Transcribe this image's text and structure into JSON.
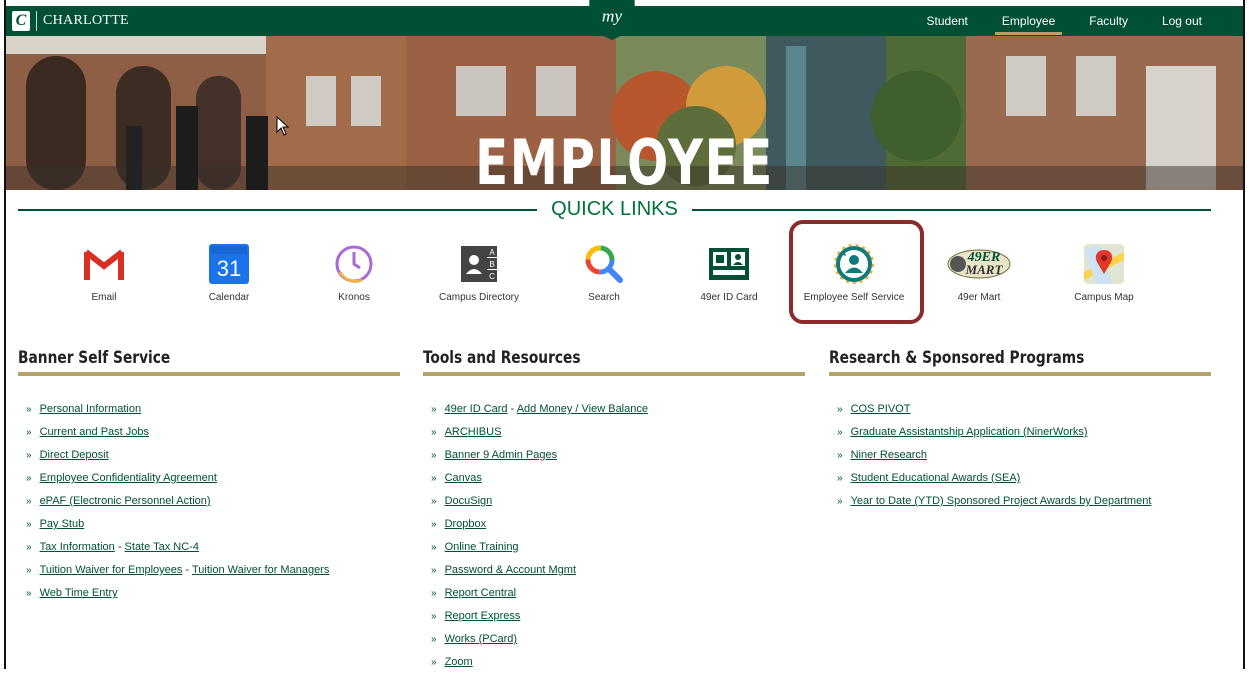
{
  "header": {
    "brand": "CHARLOTTE",
    "my_label": "my",
    "nav": [
      "Student",
      "Employee",
      "Faculty",
      "Log out"
    ],
    "active": "Employee"
  },
  "hero": {
    "title": "EMPLOYEE"
  },
  "quick_links": {
    "title": "QUICK LINKS",
    "items": [
      {
        "label": "Email",
        "icon": "gmail-icon"
      },
      {
        "label": "Calendar",
        "icon": "calendar-icon"
      },
      {
        "label": "Kronos",
        "icon": "clock-icon"
      },
      {
        "label": "Campus Directory",
        "icon": "directory-icon"
      },
      {
        "label": "Search",
        "icon": "search-icon"
      },
      {
        "label": "49er ID Card",
        "icon": "id-card-icon"
      },
      {
        "label": "Employee Self Service",
        "icon": "employee-self-service-icon"
      },
      {
        "label": "49er Mart",
        "icon": "49er-mart-logo"
      },
      {
        "label": "Campus Map",
        "icon": "map-icon"
      }
    ]
  },
  "banner": {
    "title": "Banner Self Service",
    "items": [
      [
        "Personal Information"
      ],
      [
        "Current and Past Jobs"
      ],
      [
        "Direct Deposit"
      ],
      [
        "Employee Confidentiality Agreement"
      ],
      [
        "ePAF (Electronic Personnel Action)"
      ],
      [
        "Pay Stub"
      ],
      [
        "Tax Information",
        "State Tax NC-4"
      ],
      [
        "Tuition Waiver for Employees",
        "Tuition Waiver for Managers"
      ],
      [
        "Web Time Entry"
      ]
    ]
  },
  "tools": {
    "title": "Tools and Resources",
    "items": [
      [
        "49er ID Card",
        "Add Money / View Balance"
      ],
      [
        "ARCHIBUS"
      ],
      [
        "Banner 9 Admin Pages"
      ],
      [
        "Canvas"
      ],
      [
        "DocuSign"
      ],
      [
        "Dropbox"
      ],
      [
        "Online Training"
      ],
      [
        "Password & Account Mgmt"
      ],
      [
        "Report Central"
      ],
      [
        "Report Express"
      ],
      [
        "Works (PCard)"
      ],
      [
        "Zoom"
      ]
    ]
  },
  "research": {
    "title": "Research & Sponsored Programs",
    "items": [
      [
        "COS PIVOT"
      ],
      [
        "Graduate Assistantship Application (NinerWorks)"
      ],
      [
        "Niner Research"
      ],
      [
        "Student Educational Awards (SEA)"
      ],
      [
        "Year to Date (YTD) Sponsored Project Awards by Department"
      ]
    ]
  },
  "colors": {
    "brand_green": "#005035",
    "gold": "#b3a369",
    "highlight": "#8b2b2b"
  }
}
